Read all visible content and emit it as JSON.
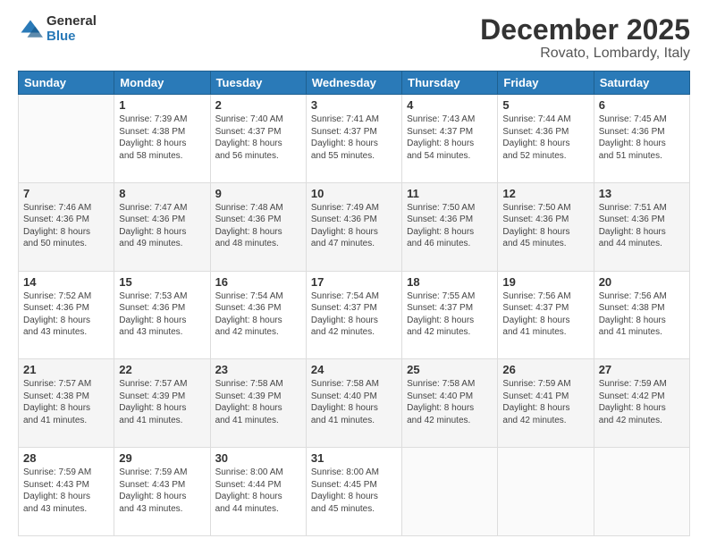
{
  "logo": {
    "general": "General",
    "blue": "Blue"
  },
  "title": "December 2025",
  "subtitle": "Rovato, Lombardy, Italy",
  "days_header": [
    "Sunday",
    "Monday",
    "Tuesday",
    "Wednesday",
    "Thursday",
    "Friday",
    "Saturday"
  ],
  "weeks": [
    [
      {
        "day": "",
        "info": ""
      },
      {
        "day": "1",
        "info": "Sunrise: 7:39 AM\nSunset: 4:38 PM\nDaylight: 8 hours\nand 58 minutes."
      },
      {
        "day": "2",
        "info": "Sunrise: 7:40 AM\nSunset: 4:37 PM\nDaylight: 8 hours\nand 56 minutes."
      },
      {
        "day": "3",
        "info": "Sunrise: 7:41 AM\nSunset: 4:37 PM\nDaylight: 8 hours\nand 55 minutes."
      },
      {
        "day": "4",
        "info": "Sunrise: 7:43 AM\nSunset: 4:37 PM\nDaylight: 8 hours\nand 54 minutes."
      },
      {
        "day": "5",
        "info": "Sunrise: 7:44 AM\nSunset: 4:36 PM\nDaylight: 8 hours\nand 52 minutes."
      },
      {
        "day": "6",
        "info": "Sunrise: 7:45 AM\nSunset: 4:36 PM\nDaylight: 8 hours\nand 51 minutes."
      }
    ],
    [
      {
        "day": "7",
        "info": "Sunrise: 7:46 AM\nSunset: 4:36 PM\nDaylight: 8 hours\nand 50 minutes."
      },
      {
        "day": "8",
        "info": "Sunrise: 7:47 AM\nSunset: 4:36 PM\nDaylight: 8 hours\nand 49 minutes."
      },
      {
        "day": "9",
        "info": "Sunrise: 7:48 AM\nSunset: 4:36 PM\nDaylight: 8 hours\nand 48 minutes."
      },
      {
        "day": "10",
        "info": "Sunrise: 7:49 AM\nSunset: 4:36 PM\nDaylight: 8 hours\nand 47 minutes."
      },
      {
        "day": "11",
        "info": "Sunrise: 7:50 AM\nSunset: 4:36 PM\nDaylight: 8 hours\nand 46 minutes."
      },
      {
        "day": "12",
        "info": "Sunrise: 7:50 AM\nSunset: 4:36 PM\nDaylight: 8 hours\nand 45 minutes."
      },
      {
        "day": "13",
        "info": "Sunrise: 7:51 AM\nSunset: 4:36 PM\nDaylight: 8 hours\nand 44 minutes."
      }
    ],
    [
      {
        "day": "14",
        "info": "Sunrise: 7:52 AM\nSunset: 4:36 PM\nDaylight: 8 hours\nand 43 minutes."
      },
      {
        "day": "15",
        "info": "Sunrise: 7:53 AM\nSunset: 4:36 PM\nDaylight: 8 hours\nand 43 minutes."
      },
      {
        "day": "16",
        "info": "Sunrise: 7:54 AM\nSunset: 4:36 PM\nDaylight: 8 hours\nand 42 minutes."
      },
      {
        "day": "17",
        "info": "Sunrise: 7:54 AM\nSunset: 4:37 PM\nDaylight: 8 hours\nand 42 minutes."
      },
      {
        "day": "18",
        "info": "Sunrise: 7:55 AM\nSunset: 4:37 PM\nDaylight: 8 hours\nand 42 minutes."
      },
      {
        "day": "19",
        "info": "Sunrise: 7:56 AM\nSunset: 4:37 PM\nDaylight: 8 hours\nand 41 minutes."
      },
      {
        "day": "20",
        "info": "Sunrise: 7:56 AM\nSunset: 4:38 PM\nDaylight: 8 hours\nand 41 minutes."
      }
    ],
    [
      {
        "day": "21",
        "info": "Sunrise: 7:57 AM\nSunset: 4:38 PM\nDaylight: 8 hours\nand 41 minutes."
      },
      {
        "day": "22",
        "info": "Sunrise: 7:57 AM\nSunset: 4:39 PM\nDaylight: 8 hours\nand 41 minutes."
      },
      {
        "day": "23",
        "info": "Sunrise: 7:58 AM\nSunset: 4:39 PM\nDaylight: 8 hours\nand 41 minutes."
      },
      {
        "day": "24",
        "info": "Sunrise: 7:58 AM\nSunset: 4:40 PM\nDaylight: 8 hours\nand 41 minutes."
      },
      {
        "day": "25",
        "info": "Sunrise: 7:58 AM\nSunset: 4:40 PM\nDaylight: 8 hours\nand 42 minutes."
      },
      {
        "day": "26",
        "info": "Sunrise: 7:59 AM\nSunset: 4:41 PM\nDaylight: 8 hours\nand 42 minutes."
      },
      {
        "day": "27",
        "info": "Sunrise: 7:59 AM\nSunset: 4:42 PM\nDaylight: 8 hours\nand 42 minutes."
      }
    ],
    [
      {
        "day": "28",
        "info": "Sunrise: 7:59 AM\nSunset: 4:43 PM\nDaylight: 8 hours\nand 43 minutes."
      },
      {
        "day": "29",
        "info": "Sunrise: 7:59 AM\nSunset: 4:43 PM\nDaylight: 8 hours\nand 43 minutes."
      },
      {
        "day": "30",
        "info": "Sunrise: 8:00 AM\nSunset: 4:44 PM\nDaylight: 8 hours\nand 44 minutes."
      },
      {
        "day": "31",
        "info": "Sunrise: 8:00 AM\nSunset: 4:45 PM\nDaylight: 8 hours\nand 45 minutes."
      },
      {
        "day": "",
        "info": ""
      },
      {
        "day": "",
        "info": ""
      },
      {
        "day": "",
        "info": ""
      }
    ]
  ]
}
